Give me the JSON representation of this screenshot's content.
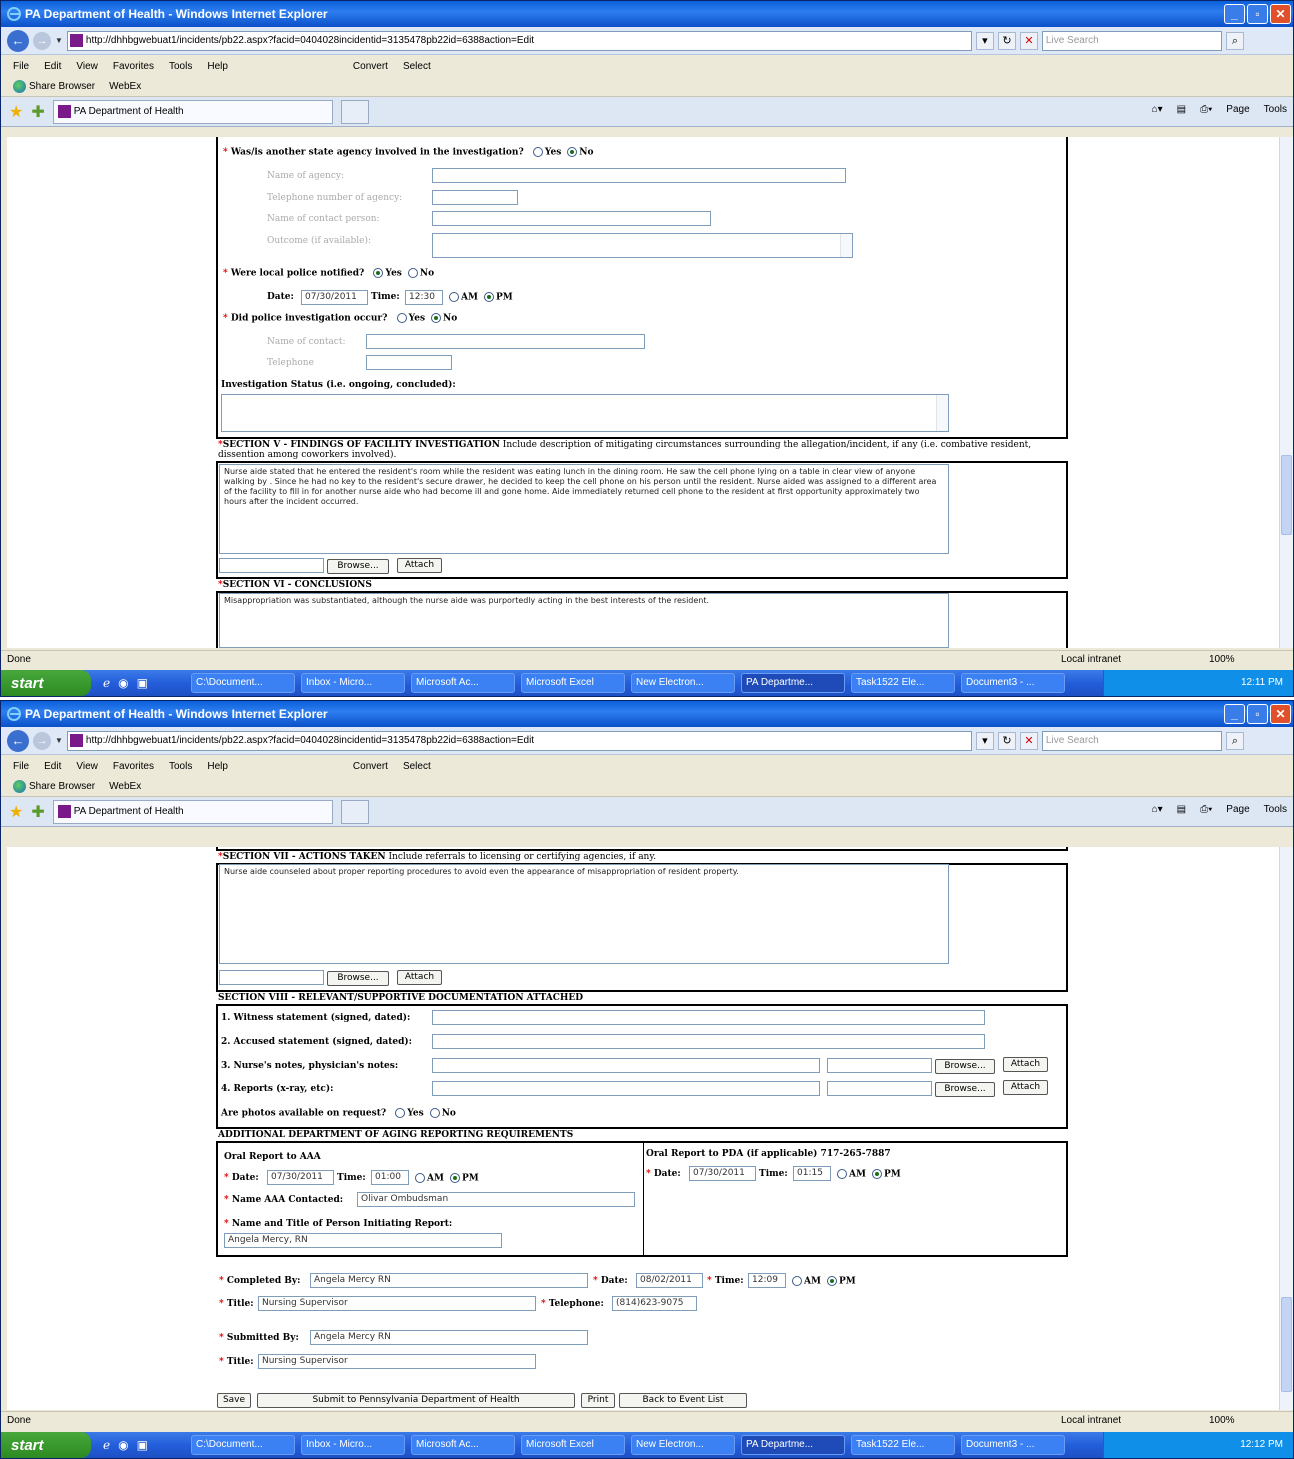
{
  "window": {
    "title": "PA Department of Health - Windows Internet Explorer",
    "url": "http://dhhbgwebuat1/incidents/pb22.aspx?facid=0404028incidentid=3135478pb22id=6388action=Edit",
    "search_placeholder": "Live Search"
  },
  "menu": [
    "File",
    "Edit",
    "View",
    "Favorites",
    "Tools",
    "Help"
  ],
  "convert": "Convert",
  "select": "Select",
  "links": {
    "share": "Share Browser",
    "webex": "WebEx"
  },
  "tab": "PA Department of Health",
  "toolbar": {
    "page": "Page",
    "tools": "Tools"
  },
  "status": {
    "done": "Done",
    "zone": "Local intranet",
    "zoom": "100%"
  },
  "taskbar": {
    "start": "start",
    "tasks": [
      "C:\\Document...",
      "Inbox - Micro...",
      "Microsoft Ac...",
      "Microsoft Excel",
      "New Electron...",
      "PA Departme...",
      "Task1522 Ele...",
      "Document3 - ..."
    ],
    "time1": "12:11 PM",
    "time2": "12:12 PM"
  },
  "f1": {
    "q_agency": "Was/is another state agency involved in the investigation?",
    "yes": "Yes",
    "no": "No",
    "agency_name": "Name of agency:",
    "agency_phone": "Telephone number of agency:",
    "contact": "Name of contact person:",
    "outcome": "Outcome (if available):",
    "q_police": "Were local police notified?",
    "date_lbl": "Date:",
    "date": "07/30/2011",
    "time_lbl": "Time:",
    "time": "12:30",
    "am": "AM",
    "pm": "PM",
    "q_invest": "Did police investigation occur?",
    "p_contact": "Name of contact:",
    "p_phone": "Telephone",
    "inv_status": "Investigation Status (i.e. ongoing, concluded):",
    "sec5_title": "SECTION V - FINDINGS OF FACILITY INVESTIGATION",
    "sec5_desc": " Include description of mitigating circumstances surrounding the allegation/incident, if any (i.e. combative resident, dissention among coworkers involved).",
    "sec5_text": "Nurse aide stated that he entered the resident's room while the resident was eating lunch in the dining room.  He saw the cell phone lying on a table in clear view of anyone walking by .  Since he had no key to the resident's secure drawer, he decided to keep the cell phone on his person until the resident.  Nurse aided was assigned to a different area of the facility to fill in for another nurse aide who had become ill and gone home.  Aide immediately returned cell phone to the resident at first opportunity approximately two hours after the incident occurred.",
    "browse": "Browse...",
    "attach": "Attach",
    "sec6_title": "SECTION VI - CONCLUSIONS",
    "sec6_text": "Misappropriation was substantiated, although the nurse aide was purportedly acting in the best interests of the resident."
  },
  "f2": {
    "sec7_title": "SECTION VII - ACTIONS TAKEN",
    "sec7_desc": " Include referrals to licensing or certifying agencies, if any.",
    "sec7_text": "Nurse aide counseled about proper reporting procedures to avoid even the appearance of misappropriation of resident property.",
    "sec8_title": "SECTION VIII - RELEVANT/SUPPORTIVE DOCUMENTATION ATTACHED",
    "d1": "1. Witness statement (signed, dated):",
    "d2": "2. Accused statement (signed, dated):",
    "d3": "3. Nurse's notes, physician's notes:",
    "d4": "4. Reports (x-ray, etc):",
    "photos": "Are photos available on request?",
    "addl": "ADDITIONAL DEPARTMENT OF AGING REPORTING REQUIREMENTS",
    "aaa": "Oral Report to AAA",
    "aaa_date": "07/30/2011",
    "aaa_time": "01:00",
    "aaa_contact_lbl": "Name AAA Contacted:",
    "aaa_contact": "Olivar Ombudsman",
    "initiator_lbl": "Name and Title of Person Initiating Report:",
    "initiator": "Angela Mercy, RN",
    "pda": "Oral Report to PDA (if applicable) 717-265-7887",
    "pda_date": "07/30/2011",
    "pda_time": "01:15",
    "completed_lbl": "Completed By:",
    "completed": "Angela Mercy RN",
    "c_date": "08/02/2011",
    "c_time": "12:09",
    "title_lbl": "Title:",
    "title": "Nursing Supervisor",
    "tel_lbl": "Telephone:",
    "tel": "(814)623-9075",
    "submitted_lbl": "Submitted By:",
    "submitted": "Angela Mercy RN",
    "title2": "Nursing Supervisor",
    "save": "Save",
    "submit": "Submit to Pennsylvania Department of Health",
    "print": "Print",
    "back": "Back to Event List"
  }
}
